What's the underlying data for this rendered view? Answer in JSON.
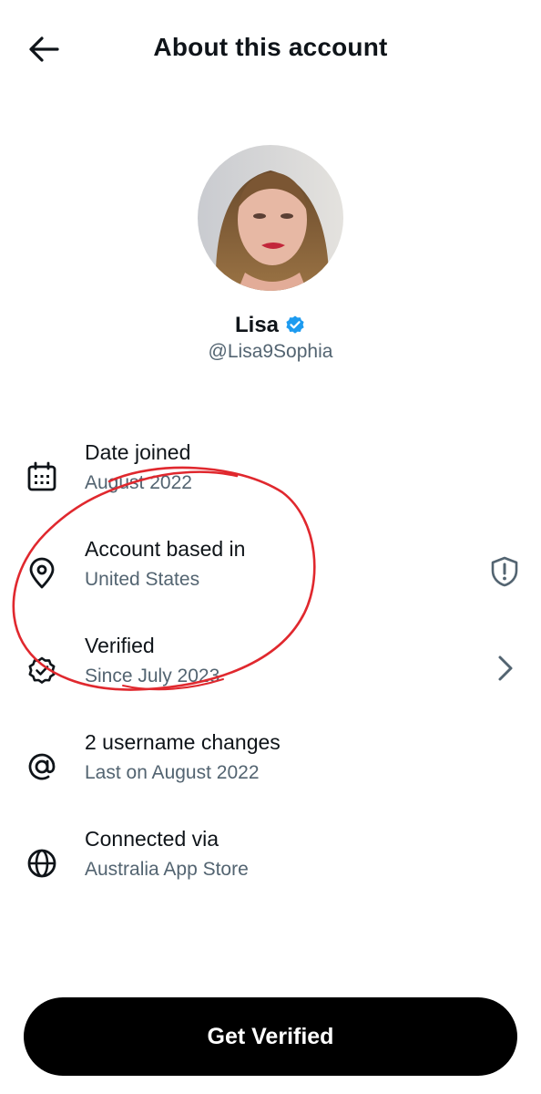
{
  "header": {
    "title": "About this account"
  },
  "profile": {
    "name": "Lisa",
    "handle": "@Lisa9Sophia"
  },
  "details": [
    {
      "icon": "calendar-icon",
      "label": "Date joined",
      "value": "August 2022"
    },
    {
      "icon": "location-pin-icon",
      "label": "Account based in",
      "value": "United States",
      "trailing_icon": "shield-exclamation-icon"
    },
    {
      "icon": "verified-badge-icon",
      "label": "Verified",
      "value": "Since July 2023",
      "trailing_icon": "chevron-right-icon"
    },
    {
      "icon": "at-sign-icon",
      "label": "2 username changes",
      "value": "Last on August 2022"
    },
    {
      "icon": "globe-icon",
      "label": "Connected via",
      "value": "Australia App Store"
    }
  ],
  "cta": {
    "label": "Get Verified"
  },
  "colors": {
    "verified_blue": "#1d9bf0",
    "annotation_red": "#e0282e",
    "secondary_text": "#536471"
  }
}
